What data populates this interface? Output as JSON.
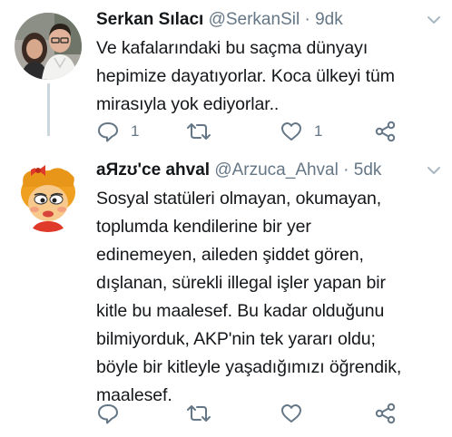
{
  "tweets": [
    {
      "name": "Serkan Sılacı",
      "handle": "@SerkanSil",
      "dot": "·",
      "time": "9dk",
      "text": "Ve kafalarındaki bu saçma dünyayı\nhepimize dayatıyorlar. Koca ülkeyi tüm\nmirasıyla yok ediyorlar..",
      "reply_count": "1",
      "retweet_count": "",
      "like_count": "1"
    },
    {
      "name": "aЯzʊ'ce ahval",
      "handle": "@Arzuca_Ahval",
      "dot": "·",
      "time": "5dk",
      "text": "Sosyal statüleri olmayan, okumayan,\ntoplumda kendilerine bir yer\nedinemeyen, aileden şiddet gören,\ndışlanan, sürekli illegal işler yapan bir\nkitle bu maalesef. Bu kadar olduğunu\nbilmiyorduk, AKP'nin tek yararı oldu;\nböyle bir kitleyle yaşadığımızı öğrendik,\nmaalesef.",
      "reply_count": "",
      "retweet_count": "",
      "like_count": ""
    }
  ],
  "icons": {
    "more": "chevron-down-icon",
    "reply": "reply-icon",
    "retweet": "retweet-icon",
    "like": "heart-icon",
    "share": "share-icon"
  },
  "colors": {
    "text": "#14171a",
    "secondary": "#657786",
    "thread_line": "#ccd6dd"
  }
}
